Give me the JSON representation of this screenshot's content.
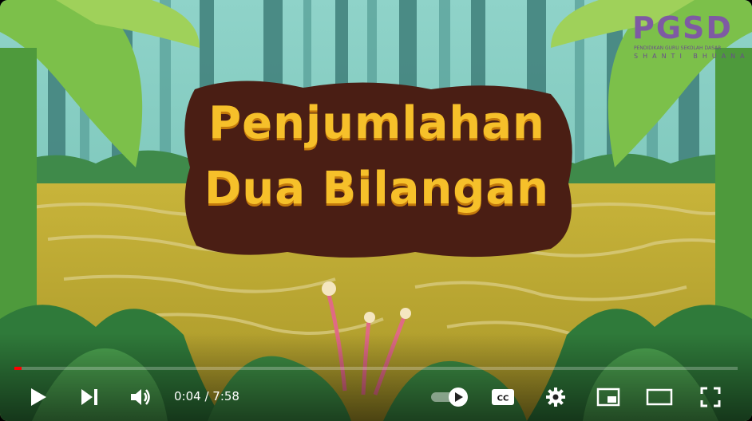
{
  "video": {
    "title_line1": "Penjumlahan",
    "title_line2": "Dua Bilangan"
  },
  "logo": {
    "main": "PGSD",
    "subtitle": "PENDIDIKAN GURU SEKOLAH DASAR",
    "subtitle2": "SHANTI BHUANA"
  },
  "player": {
    "current_time": "0:04",
    "separator": " / ",
    "duration": "7:58",
    "progress_fraction": 0.01,
    "accent_color": "#ff0000",
    "icons": [
      "play-icon",
      "next-icon",
      "volume-icon",
      "autoplay-toggle-icon",
      "captions-icon",
      "settings-icon",
      "miniplayer-icon",
      "theater-icon",
      "fullscreen-icon"
    ],
    "captions_label": "CC"
  }
}
